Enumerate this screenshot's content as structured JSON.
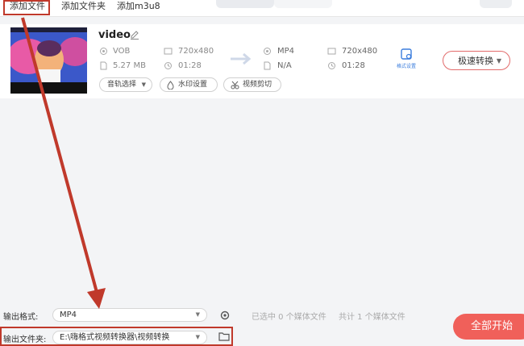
{
  "toolbar": {
    "add_file": "添加文件",
    "add_folder": "添加文件夹",
    "add_m3u8": "添加m3u8"
  },
  "file": {
    "name": "video",
    "src_format": "VOB",
    "src_resolution": "720x480",
    "src_size": "5.27 MB",
    "src_duration": "01:28",
    "dst_format": "MP4",
    "dst_resolution": "720x480",
    "dst_size": "N/A",
    "dst_duration": "01:28",
    "settings_label": "格式设置",
    "convert_label": "极速转换",
    "audio_track_label": "音轨选择",
    "watermark_label": "水印设置",
    "clip_label": "视频剪切"
  },
  "bottom": {
    "output_format_label": "输出格式:",
    "output_format_value": "MP4",
    "output_folder_label": "输出文件夹:",
    "output_folder_value": "E:\\嗨格式视频转换器\\视频转换",
    "selected_status": "已选中 0 个媒体文件",
    "total_status": "共计 1 个媒体文件",
    "start_all": "全部开始"
  },
  "colors": {
    "accent": "#f0605a",
    "link": "#3b7ddd",
    "annotation": "#c0392b"
  }
}
